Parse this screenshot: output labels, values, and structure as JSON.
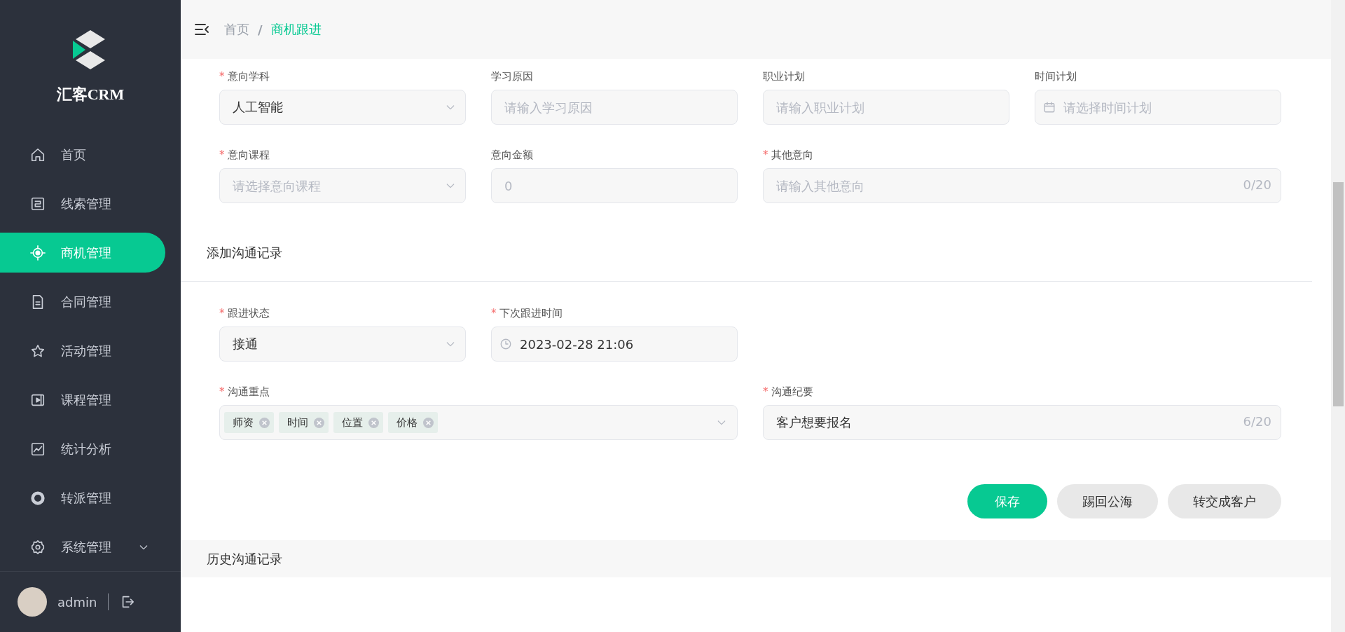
{
  "required_mark": "*",
  "sidebar": {
    "brand": "汇客CRM",
    "items": [
      {
        "label": "首页",
        "selected": false
      },
      {
        "label": "线索管理",
        "selected": false
      },
      {
        "label": "商机管理",
        "selected": true
      },
      {
        "label": "合同管理",
        "selected": false
      },
      {
        "label": "活动管理",
        "selected": false
      },
      {
        "label": "课程管理",
        "selected": false
      },
      {
        "label": "统计分析",
        "selected": false
      },
      {
        "label": "转派管理",
        "selected": false
      },
      {
        "label": "系统管理",
        "selected": false,
        "expanded": false
      }
    ],
    "user": {
      "name": "admin"
    }
  },
  "header": {
    "separator": "/",
    "breadcrumb": [
      {
        "label": "首页",
        "selected": false
      },
      {
        "label": "商机跟进",
        "selected": true
      }
    ]
  },
  "intent_form": {
    "rows": [
      [
        {
          "label": "意向学科",
          "required": true,
          "kind": "select",
          "value": "人工智能"
        },
        {
          "label": "学习原因",
          "required": false,
          "kind": "input",
          "placeholder": "请输入学习原因"
        },
        {
          "label": "职业计划",
          "required": false,
          "kind": "input",
          "placeholder": "请输入职业计划"
        },
        {
          "label": "时间计划",
          "required": false,
          "kind": "date",
          "placeholder": "请选择时间计划"
        }
      ],
      [
        {
          "label": "意向课程",
          "required": true,
          "kind": "select",
          "placeholder": "请选择意向课程"
        },
        {
          "label": "意向金额",
          "required": false,
          "kind": "input",
          "placeholder": "0"
        },
        {
          "label": "其他意向",
          "required": true,
          "kind": "input",
          "placeholder": "请输入其他意向",
          "counter": "0/20",
          "wide": true
        }
      ]
    ]
  },
  "follow_up": {
    "title": "添加沟通记录",
    "rows": [
      [
        {
          "label": "跟进状态",
          "required": true,
          "kind": "select",
          "value": "接通"
        },
        {
          "label": "下次跟进时间",
          "required": true,
          "kind": "datetime",
          "value": "2023-02-28 21:06"
        }
      ],
      [
        {
          "label": "沟通重点",
          "required": true,
          "kind": "tags",
          "wide": true,
          "tags": [
            "师资",
            "时间",
            "位置",
            "价格"
          ]
        },
        {
          "label": "沟通纪要",
          "required": true,
          "kind": "input",
          "value": "客户想要报名",
          "counter": "6/20",
          "wide": true
        }
      ]
    ],
    "buttons": [
      {
        "label": "保存",
        "kind": "primary"
      },
      {
        "label": "踢回公海",
        "kind": "default"
      },
      {
        "label": "转交成客户",
        "kind": "default"
      }
    ]
  },
  "history": {
    "title": "历史沟通记录"
  }
}
